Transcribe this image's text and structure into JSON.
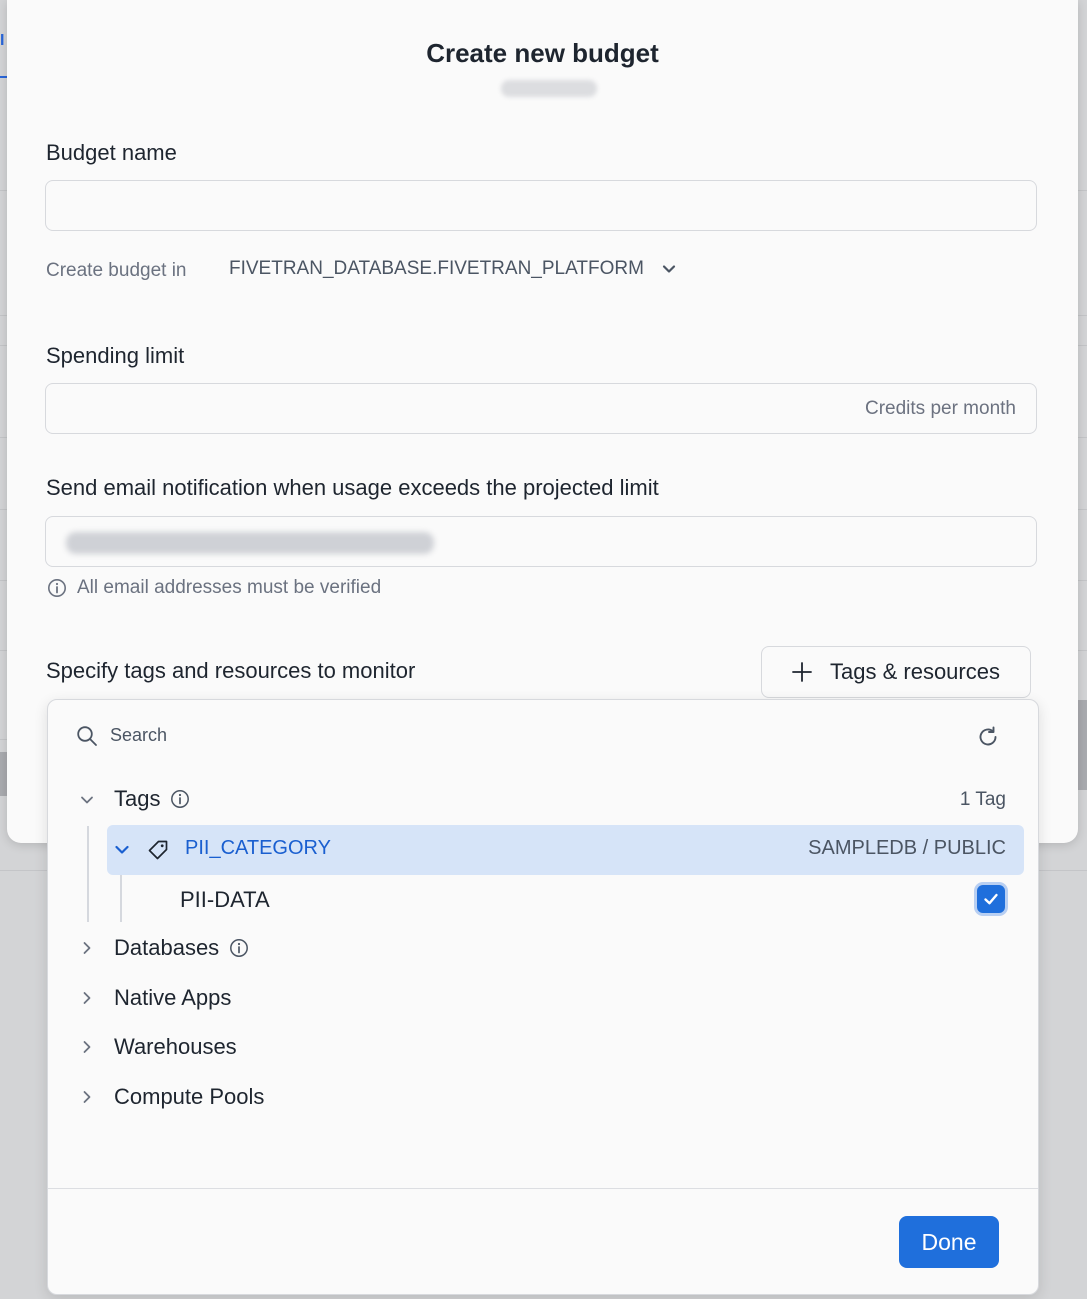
{
  "background": {
    "tab_fragment": "I"
  },
  "modal": {
    "title": "Create new budget",
    "budget_name": {
      "label": "Budget name",
      "value": "",
      "placeholder": ""
    },
    "create_in": {
      "label": "Create budget in",
      "value": "FIVETRAN_DATABASE.FIVETRAN_PLATFORM"
    },
    "spending_limit": {
      "label": "Spending limit",
      "value": "",
      "placeholder": "Credits per month"
    },
    "email": {
      "label": "Send email notification when usage exceeds the projected limit",
      "hint": "All email addresses must be verified"
    },
    "monitor": {
      "label": "Specify tags and resources to monitor",
      "button_label": "Tags & resources"
    }
  },
  "picker": {
    "search_placeholder": "Search",
    "tree": {
      "tags": {
        "label": "Tags",
        "count": "1 Tag"
      },
      "selected_tag": {
        "name": "PII_CATEGORY",
        "path": "SAMPLEDB / PUBLIC"
      },
      "tag_value": {
        "label": "PII-DATA",
        "checked": true
      },
      "databases": {
        "label": "Databases"
      },
      "native_apps": {
        "label": "Native Apps"
      },
      "warehouses": {
        "label": "Warehouses"
      },
      "compute_pools": {
        "label": "Compute Pools"
      }
    },
    "done_label": "Done"
  },
  "colors": {
    "accent": "#1f6fdc",
    "selected_row": "#d6e4f8",
    "selected_text": "#1a5fd0"
  },
  "icons": [
    "chevron-down-icon",
    "info-icon",
    "plus-icon",
    "search-icon",
    "refresh-icon",
    "chevron-right-icon",
    "tag-icon",
    "checkmark-icon"
  ]
}
